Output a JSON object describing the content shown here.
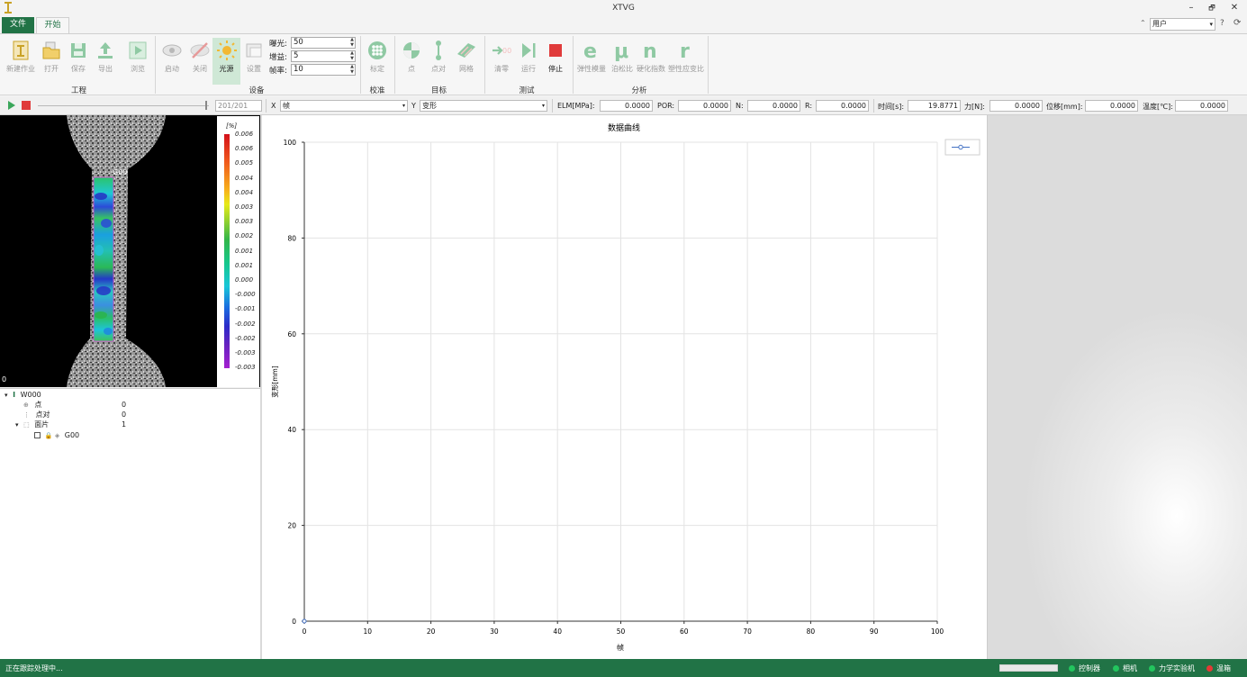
{
  "window": {
    "title": "XTVG",
    "minimize": "–",
    "restore": "🗗",
    "close": "✕"
  },
  "tabs": {
    "file": "文件",
    "start": "开始"
  },
  "user": {
    "value": "用户",
    "help": "?",
    "refresh": "⟳"
  },
  "ribbon": {
    "groups": {
      "project": "工程",
      "device": "设备",
      "calibration": "校准",
      "target": "目标",
      "test": "测试",
      "analysis": "分析"
    },
    "buttons": {
      "new_job": "新建作业",
      "open": "打开",
      "save": "保存",
      "export": "导出",
      "browse": "浏览",
      "start": "启动",
      "close": "关闭",
      "light": "光源",
      "settings": "设置",
      "calibrate": "标定",
      "point": "点",
      "point_pair": "点对",
      "mesh": "网格",
      "clear_zero": "清零",
      "run": "运行",
      "stop": "停止",
      "elastic_modulus": "弹性模量",
      "poisson": "泊松比",
      "hardening": "硬化指数",
      "plastic_strain": "塑性应变比"
    },
    "params": {
      "exposure_label": "曝光:",
      "exposure_value": "50",
      "gain_label": "增益:",
      "gain_value": "5",
      "fps_label": "帧率:",
      "fps_value": "10"
    }
  },
  "controls": {
    "frame_counter": "201/201",
    "x_label": "X",
    "x_value": "帧",
    "y_label": "Y",
    "y_value": "变形",
    "elm_label": "ELM[MPa]:",
    "elm_value": "0.0000",
    "por_label": "POR:",
    "por_value": "0.0000",
    "n_label": "N:",
    "n_value": "0.0000",
    "r_label": "R:",
    "r_value": "0.0000",
    "time_label": "时间[s]:",
    "time_value": "19.8771",
    "force_label": "力[N]:",
    "force_value": "0.0000",
    "disp_label": "位移[mm]:",
    "disp_value": "0.0000",
    "temp_label": "温度[℃]:",
    "temp_value": "0.0000"
  },
  "image_view": {
    "region_label": "G00",
    "corner_label": "0",
    "colorbar_unit": "[%]",
    "colorbar_ticks": [
      "0.006",
      "0.006",
      "0.005",
      "0.004",
      "0.004",
      "0.003",
      "0.003",
      "0.002",
      "0.001",
      "0.001",
      "0.000",
      "-0.000",
      "-0.001",
      "-0.002",
      "-0.002",
      "-0.003",
      "-0.003"
    ]
  },
  "tree": {
    "root": "W000",
    "items": [
      {
        "label": "点",
        "value": "0"
      },
      {
        "label": "点对",
        "value": "0"
      },
      {
        "label": "面片",
        "value": "1"
      }
    ],
    "child": "G00"
  },
  "chart_data": {
    "type": "line",
    "title": "数据曲线",
    "xlabel": "帧",
    "ylabel": "变形[mm]",
    "xlim": [
      0,
      100
    ],
    "ylim": [
      0,
      100
    ],
    "xticks": [
      0,
      10,
      20,
      30,
      40,
      50,
      60,
      70,
      80,
      90,
      100
    ],
    "yticks": [
      0,
      20,
      40,
      60,
      80,
      100
    ],
    "grid": true,
    "legend": "top-right",
    "series": [
      {
        "x": [
          0
        ],
        "y": [
          0
        ],
        "color": "#4472c4"
      }
    ]
  },
  "status": {
    "message": "正在跟踪处理中...",
    "indicators": [
      {
        "label": "控制器",
        "color": "#22c55e"
      },
      {
        "label": "相机",
        "color": "#22c55e"
      },
      {
        "label": "力学实验机",
        "color": "#22c55e"
      },
      {
        "label": "温箱",
        "color": "#e53935"
      }
    ]
  },
  "colors": {
    "accent": "#217346",
    "active_button": "#cfe8d6",
    "stop_red": "#e03b3b"
  }
}
